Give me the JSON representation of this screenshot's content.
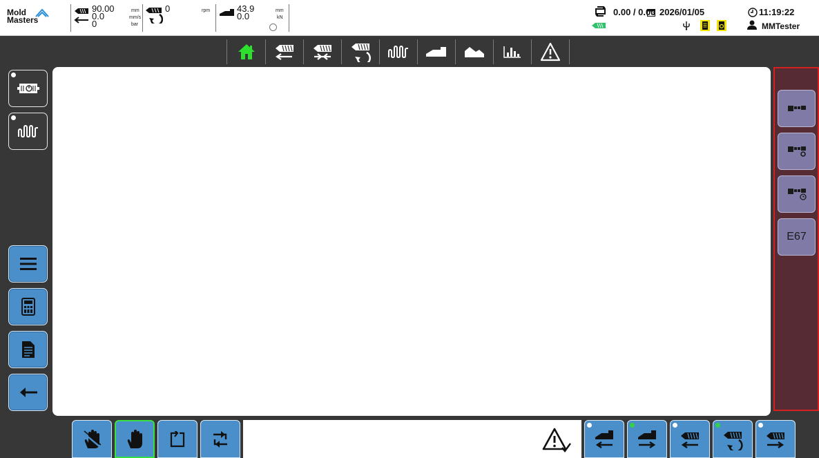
{
  "brand": {
    "line1": "Mold",
    "line2": "Masters"
  },
  "status": {
    "injection_position": "90.00",
    "injection_position_unit": "mm",
    "injection_speed": "0.0",
    "injection_speed_unit": "mm/s",
    "injection_pressure": "0",
    "injection_pressure_unit": "bar",
    "screw_rpm": "0",
    "screw_rpm_unit": "rpm",
    "carriage_position": "43.9",
    "carriage_position_unit": "mm",
    "carriage_force": "0.0",
    "carriage_force_unit": "kN",
    "cycle_values": "0.00 / 0.00",
    "date": "2026/01/05",
    "time": "11:19:22",
    "user": "MMTester"
  },
  "top_nav": [
    {
      "name": "home",
      "icon": "home-icon",
      "active": true
    },
    {
      "name": "injection",
      "icon": "injection-icon"
    },
    {
      "name": "hold",
      "icon": "hold-pressure-icon"
    },
    {
      "name": "screw",
      "icon": "screw-rotation-icon"
    },
    {
      "name": "heaters",
      "icon": "heater-zones-icon"
    },
    {
      "name": "carriage",
      "icon": "carriage-icon"
    },
    {
      "name": "graph",
      "icon": "area-graph-icon"
    },
    {
      "name": "statistics",
      "icon": "bar-chart-icon"
    },
    {
      "name": "alarms",
      "icon": "warning-icon"
    }
  ],
  "left_buttons": [
    {
      "name": "heaters-power",
      "icon": "heater-power-icon"
    },
    {
      "name": "heater-zones",
      "icon": "heater-zones-icon"
    },
    {
      "name": "menu",
      "icon": "hamburger-menu-icon"
    },
    {
      "name": "calculator",
      "icon": "calculator-icon"
    },
    {
      "name": "document",
      "icon": "document-icon"
    },
    {
      "name": "back",
      "icon": "back-arrow-icon"
    }
  ],
  "right_buttons": [
    {
      "name": "mode-1",
      "icon": "unit-mode-icon"
    },
    {
      "name": "mode-settings",
      "icon": "unit-settings-icon"
    },
    {
      "name": "mode-timer",
      "icon": "unit-timer-icon"
    },
    {
      "name": "e67",
      "label": "E67"
    }
  ],
  "bottom_left": [
    {
      "name": "purge",
      "icon": "purge-hand-icon"
    },
    {
      "name": "manual",
      "icon": "manual-hand-icon",
      "selected": true
    },
    {
      "name": "semi-auto",
      "icon": "semi-auto-icon"
    },
    {
      "name": "auto",
      "icon": "auto-cycle-icon"
    }
  ],
  "bottom_right": [
    {
      "name": "carriage-back",
      "icon": "carriage-back-icon",
      "led": "white"
    },
    {
      "name": "carriage-forward",
      "icon": "carriage-forward-icon",
      "led": "green"
    },
    {
      "name": "injection-back",
      "icon": "injection-back-icon",
      "led": "white"
    },
    {
      "name": "screw-rotate",
      "icon": "screw-rotate-icon",
      "led": "green"
    },
    {
      "name": "injection-forward",
      "icon": "injection-forward-icon",
      "led": "white"
    }
  ],
  "colors": {
    "accent_blue": "#4a8fc9",
    "panel_purple": "#7f7aa6",
    "right_bg": "#562b33",
    "highlight_red": "#d62020",
    "home_green": "#2ee02e",
    "led_green": "#33d14a",
    "alert_yellow": "#f5e400"
  }
}
